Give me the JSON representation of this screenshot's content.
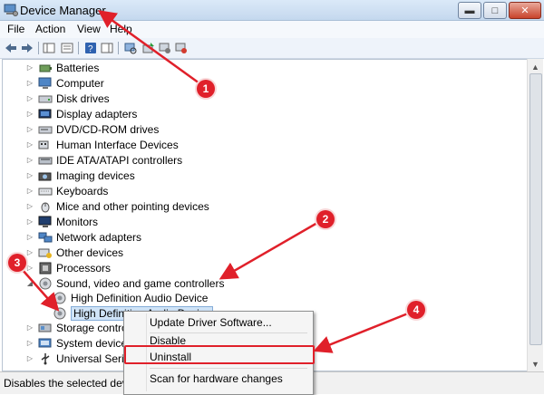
{
  "window": {
    "title": "Device Manager",
    "controls": {
      "minimize": "▬",
      "maximize": "□",
      "close": "✕"
    }
  },
  "menu": [
    "File",
    "Action",
    "View",
    "Help"
  ],
  "toolbar": {
    "buttons": [
      "back-icon",
      "forward-icon",
      "show-hide-console-tree-icon",
      "properties-icon",
      "help-icon",
      "show-hide-action-pane-icon",
      "scan-hardware-icon",
      "update-driver-icon",
      "disable-device-icon",
      "uninstall-device-icon"
    ]
  },
  "tree": {
    "items": [
      {
        "label": "Batteries",
        "icon": "battery-icon",
        "expander": "▷"
      },
      {
        "label": "Computer",
        "icon": "computer-icon",
        "expander": "▷"
      },
      {
        "label": "Disk drives",
        "icon": "disk-drive-icon",
        "expander": "▷"
      },
      {
        "label": "Display adapters",
        "icon": "display-adapter-icon",
        "expander": "▷"
      },
      {
        "label": "DVD/CD-ROM drives",
        "icon": "dvd-drive-icon",
        "expander": "▷"
      },
      {
        "label": "Human Interface Devices",
        "icon": "hid-icon",
        "expander": "▷"
      },
      {
        "label": "IDE ATA/ATAPI controllers",
        "icon": "ide-controller-icon",
        "expander": "▷"
      },
      {
        "label": "Imaging devices",
        "icon": "camera-icon",
        "expander": "▷"
      },
      {
        "label": "Keyboards",
        "icon": "keyboard-icon",
        "expander": "▷"
      },
      {
        "label": "Mice and other pointing devices",
        "icon": "mouse-icon",
        "expander": "▷"
      },
      {
        "label": "Monitors",
        "icon": "monitor-icon",
        "expander": "▷"
      },
      {
        "label": "Network adapters",
        "icon": "network-adapter-icon",
        "expander": "▷"
      },
      {
        "label": "Other devices",
        "icon": "other-device-icon",
        "expander": "▷"
      },
      {
        "label": "Processors",
        "icon": "processor-icon",
        "expander": "▷"
      },
      {
        "label": "Sound, video and game controllers",
        "icon": "speaker-icon",
        "expander": "◢"
      },
      {
        "label": "High Definition Audio Device",
        "icon": "speaker-icon",
        "expander": ""
      },
      {
        "label": "High Definition Audio Device",
        "icon": "speaker-icon",
        "expander": "",
        "selected": true
      },
      {
        "label": "Storage controllers",
        "icon": "storage-controller-icon",
        "expander": "▷"
      },
      {
        "label": "System devices",
        "icon": "system-device-icon",
        "expander": "▷"
      },
      {
        "label": "Universal Serial Bus controllers",
        "icon": "usb-icon",
        "expander": "▷"
      }
    ]
  },
  "context_menu": {
    "items": [
      "Update Driver Software...",
      "Disable",
      "Uninstall",
      "Scan for hardware changes"
    ]
  },
  "status_bar": {
    "text": "Disables the selected device."
  },
  "annotations": {
    "callouts": [
      "1",
      "2",
      "3",
      "4"
    ],
    "color": "#e0202a"
  },
  "colors": {
    "selection": "#cfe3f7",
    "titlebar": "#c4d8ee"
  }
}
